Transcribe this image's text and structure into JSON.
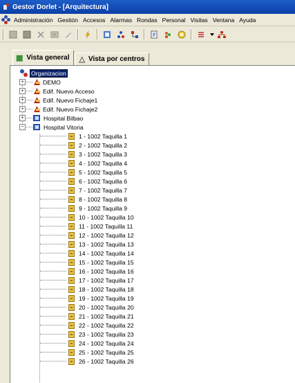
{
  "window": {
    "title": "Gestor Dorlet - [Arquitectura]"
  },
  "menu": [
    {
      "label": "Administración"
    },
    {
      "label": "Gestión"
    },
    {
      "label": "Accesos"
    },
    {
      "label": "Alarmas"
    },
    {
      "label": "Rondas"
    },
    {
      "label": "Personal"
    },
    {
      "label": "Visitas"
    },
    {
      "label": "Ventana"
    },
    {
      "label": "Ayuda"
    }
  ],
  "toolbar": {
    "buttons": [
      {
        "icon": "new-record-icon"
      },
      {
        "icon": "save-record-icon"
      },
      {
        "icon": "delete-icon"
      },
      {
        "icon": "properties-icon"
      },
      {
        "icon": "pen-icon"
      },
      {
        "icon": "lightning-icon"
      },
      {
        "icon": "refresh-icon"
      },
      {
        "icon": "tree-icon"
      },
      {
        "icon": "network-icon"
      },
      {
        "icon": "report-icon"
      },
      {
        "icon": "people-icon"
      },
      {
        "icon": "disk-icon"
      },
      {
        "icon": "arrows-icon"
      },
      {
        "icon": "sitemap-icon"
      }
    ]
  },
  "tabs": [
    {
      "label": "Vista general",
      "icon": "tree-view-icon",
      "active": true
    },
    {
      "label": "Vista por centros",
      "icon": "pyramid-icon",
      "active": false
    }
  ],
  "tree": {
    "root": "Organizacion",
    "nodes": [
      {
        "label": "DEMO",
        "type": "plant",
        "expanded": false
      },
      {
        "label": "Edif. Nuevo Acceso",
        "type": "plant",
        "expanded": false
      },
      {
        "label": "Edif. Nuevo Fichaje1",
        "type": "plant",
        "expanded": false
      },
      {
        "label": "Edif. Nuevo Fichaje2",
        "type": "plant",
        "expanded": false
      },
      {
        "label": "Hospital Bilbao",
        "type": "host",
        "expanded": false
      },
      {
        "label": "Hospital Vitoria",
        "type": "host",
        "expanded": true
      }
    ],
    "lockers": [
      "1 - 1002 Taquilla 1",
      "2 - 1002 Taquilla 2",
      "3 - 1002 Taquilla 3",
      "4 - 1002 Taquilla 4",
      "5 - 1002 Taquilla 5",
      "6 - 1002 Taquilla 6",
      "7 - 1002 Taquilla 7",
      "8 - 1002 Taquilla 8",
      "9 - 1002 Taquilla 9",
      "10 - 1002 Taquilla 10",
      "11 - 1002 Taquilla 11",
      "12 - 1002 Taquilla 12",
      "13 - 1002 Taquilla 13",
      "14 - 1002 Taquilla 14",
      "15 - 1002 Taquilla 15",
      "16 - 1002 Taquilla 16",
      "17 - 1002 Taquilla 17",
      "18 - 1002 Taquilla 18",
      "19 - 1002 Taquilla 19",
      "20 - 1002 Taquilla 20",
      "21 - 1002 Taquilla 21",
      "22 - 1002 Taquilla 22",
      "23 - 1002 Taquilla 23",
      "24 - 1002 Taquilla 24",
      "25 - 1002 Taquilla 25",
      "26 - 1002 Taquilla 26"
    ]
  },
  "colors": {
    "titlebar": "#0a3fa8",
    "selection": "#0a246a",
    "window_bg": "#ece9d8"
  }
}
